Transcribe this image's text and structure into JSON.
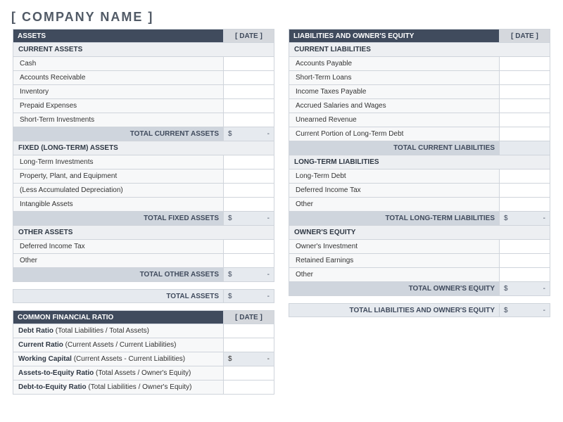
{
  "company": "[ COMPANY NAME ]",
  "date_placeholder": "[ DATE ]",
  "currency": "$",
  "dash": "-",
  "assets": {
    "title": "ASSETS",
    "current_title": "CURRENT ASSETS",
    "current": [
      {
        "label": "Cash"
      },
      {
        "label": "Accounts Receivable"
      },
      {
        "label": "Inventory"
      },
      {
        "label": "Prepaid Expenses"
      },
      {
        "label": "Short-Term Investments"
      }
    ],
    "current_total": "TOTAL CURRENT ASSETS",
    "fixed_title": "FIXED (LONG-TERM) ASSETS",
    "fixed": [
      {
        "label": "Long-Term Investments"
      },
      {
        "label": "Property, Plant, and Equipment"
      },
      {
        "label": "(Less Accumulated Depreciation)"
      },
      {
        "label": "Intangible Assets"
      }
    ],
    "fixed_total": "TOTAL FIXED ASSETS",
    "other_title": "OTHER ASSETS",
    "other": [
      {
        "label": "Deferred Income Tax"
      },
      {
        "label": "Other"
      }
    ],
    "other_total": "TOTAL OTHER ASSETS",
    "grand_total": "TOTAL ASSETS"
  },
  "liabilities": {
    "title": "LIABILITIES AND OWNER'S EQUITY",
    "current_title": "CURRENT LIABILITIES",
    "current": [
      {
        "label": "Accounts Payable"
      },
      {
        "label": "Short-Term Loans"
      },
      {
        "label": "Income Taxes Payable"
      },
      {
        "label": "Accrued Salaries and Wages"
      },
      {
        "label": "Unearned Revenue"
      },
      {
        "label": "Current Portion of Long-Term Debt"
      }
    ],
    "current_total": "TOTAL CURRENT LIABILITIES",
    "long_title": "LONG-TERM LIABILITIES",
    "long": [
      {
        "label": "Long-Term Debt"
      },
      {
        "label": "Deferred Income Tax"
      },
      {
        "label": "Other"
      }
    ],
    "long_total": "TOTAL LONG-TERM LIABILITIES",
    "equity_title": "OWNER'S EQUITY",
    "equity": [
      {
        "label": "Owner's Investment"
      },
      {
        "label": "Retained Earnings"
      },
      {
        "label": "Other"
      }
    ],
    "equity_total": "TOTAL OWNER'S EQUITY",
    "grand_total": "TOTAL LIABILITIES AND OWNER'S EQUITY"
  },
  "ratios": {
    "title": "COMMON FINANCIAL RATIO",
    "rows": [
      {
        "name": "Debt Ratio",
        "formula": " (Total Liabilities / Total Assets)"
      },
      {
        "name": "Current Ratio",
        "formula": " (Current Assets / Current Liabilities)"
      },
      {
        "name": "Working Capital",
        "formula": " (Current Assets - Current Liabilities)",
        "money": true
      },
      {
        "name": "Assets-to-Equity Ratio",
        "formula": " (Total Assets / Owner's Equity)"
      },
      {
        "name": "Debt-to-Equity Ratio",
        "formula": " (Total Liabilities / Owner's Equity)"
      }
    ]
  }
}
